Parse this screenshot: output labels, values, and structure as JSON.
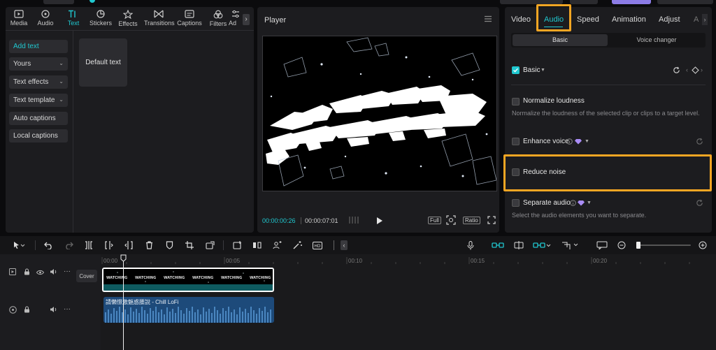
{
  "top_tabs": [
    {
      "label": "Media",
      "icon": "media-icon"
    },
    {
      "label": "Audio",
      "icon": "audio-icon"
    },
    {
      "label": "Text",
      "icon": "text-icon"
    },
    {
      "label": "Stickers",
      "icon": "stickers-icon"
    },
    {
      "label": "Effects",
      "icon": "effects-icon"
    },
    {
      "label": "Transitions",
      "icon": "transitions-icon"
    },
    {
      "label": "Captions",
      "icon": "captions-icon"
    },
    {
      "label": "Filters",
      "icon": "filters-icon"
    },
    {
      "label": "Ad",
      "icon": "adjust-icon"
    }
  ],
  "text_sidebar": [
    {
      "label": "Add text"
    },
    {
      "label": "Yours",
      "chevron": "⌄"
    },
    {
      "label": "Text effects",
      "chevron": "⌄"
    },
    {
      "label": "Text template",
      "chevron": "⌄"
    },
    {
      "label": "Auto captions"
    },
    {
      "label": "Local captions"
    }
  ],
  "default_text_card": "Default text",
  "player": {
    "title": "Player",
    "current_time": "00:00:00:26",
    "total_time": "00:00:07:01",
    "full_btn": "Full",
    "ratio_btn": "Ratio"
  },
  "right_tabs": [
    "Video",
    "Audio",
    "Speed",
    "Animation",
    "Adjust",
    "A"
  ],
  "subtabs": {
    "basic": "Basic",
    "voice_changer": "Voice changer"
  },
  "basic_section": {
    "label": "Basic"
  },
  "normalize": {
    "label": "Normalize loudness",
    "desc": "Normalize the loudness of the selected clip or clips to a target level."
  },
  "enhance": {
    "label": "Enhance voice"
  },
  "reduce": {
    "label": "Reduce noise"
  },
  "separate": {
    "label": "Separate audio",
    "desc": "Select the audio elements you want to separate."
  },
  "timeline": {
    "ticks": [
      "00:00",
      "00:05",
      "00:10",
      "00:15",
      "00:20"
    ],
    "cover_label": "Cover",
    "video_thumb_text": "WATCHING",
    "audio_clip_label": "請懶憬激魅惑腰說 - Chill LoFi"
  },
  "colors": {
    "accent": "#20c8d0",
    "highlight": "#f5a623"
  }
}
